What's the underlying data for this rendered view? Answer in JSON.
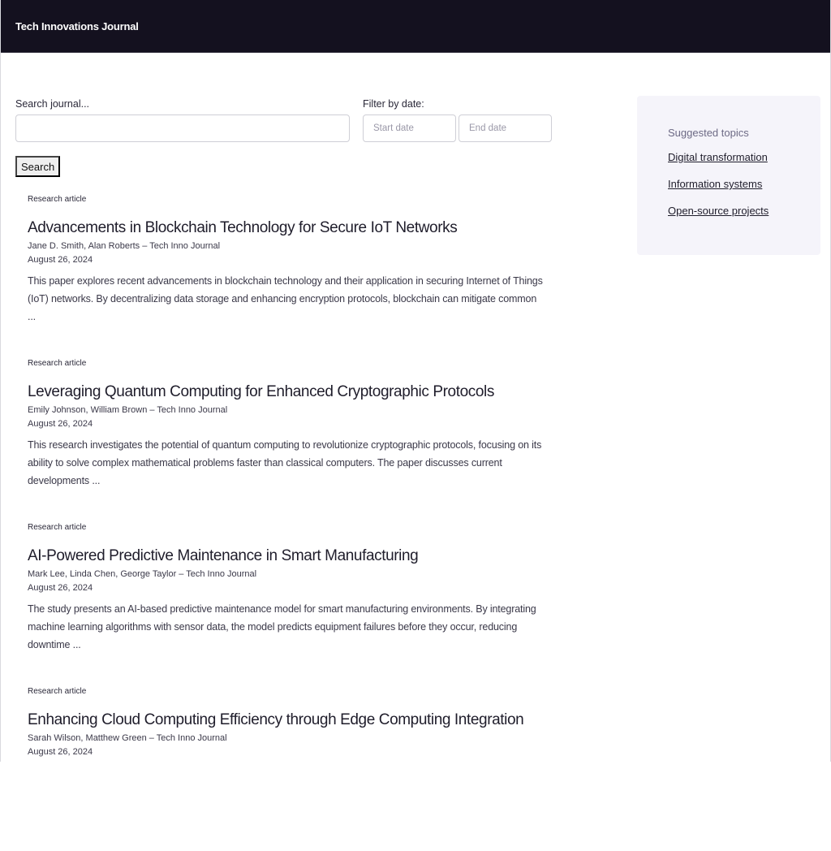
{
  "header": {
    "brand": "Tech Innovations Journal"
  },
  "search": {
    "label": "Search journal...",
    "value": "",
    "placeholder": "",
    "button_label": "Search"
  },
  "date_filter": {
    "label": "Filter by date:",
    "start_placeholder": "Start date",
    "end_placeholder": "End date"
  },
  "articles": [
    {
      "type": "Research article",
      "title": "Advancements in Blockchain Technology for Secure IoT Networks",
      "authors": "Jane D. Smith, Alan Roberts – Tech Inno Journal",
      "date": "August 26, 2024",
      "abstract": "This paper explores recent advancements in blockchain technology and their application in securing Internet of Things (IoT) networks. By decentralizing data storage and enhancing encryption protocols, blockchain can mitigate common ..."
    },
    {
      "type": "Research article",
      "title": "Leveraging Quantum Computing for Enhanced Cryptographic Protocols",
      "authors": "Emily Johnson, William Brown – Tech Inno Journal",
      "date": "August 26, 2024",
      "abstract": "This research investigates the potential of quantum computing to revolutionize cryptographic protocols, focusing on its ability to solve complex mathematical problems faster than classical computers. The paper discusses current developments ..."
    },
    {
      "type": "Research article",
      "title": "AI-Powered Predictive Maintenance in Smart Manufacturing",
      "authors": "Mark Lee, Linda Chen, George Taylor – Tech Inno Journal",
      "date": "August 26, 2024",
      "abstract": "The study presents an AI-based predictive maintenance model for smart manufacturing environments. By integrating machine learning algorithms with sensor data, the model predicts equipment failures before they occur, reducing downtime ..."
    },
    {
      "type": "Research article",
      "title": "Enhancing Cloud Computing Efficiency through Edge Computing Integration",
      "authors": "Sarah Wilson, Matthew Green – Tech Inno Journal",
      "date": "August 26, 2024",
      "abstract": ""
    }
  ],
  "sidebar": {
    "title": "Suggested topics",
    "topics": [
      "Digital transformation",
      "Information systems",
      "Open-source projects"
    ]
  }
}
